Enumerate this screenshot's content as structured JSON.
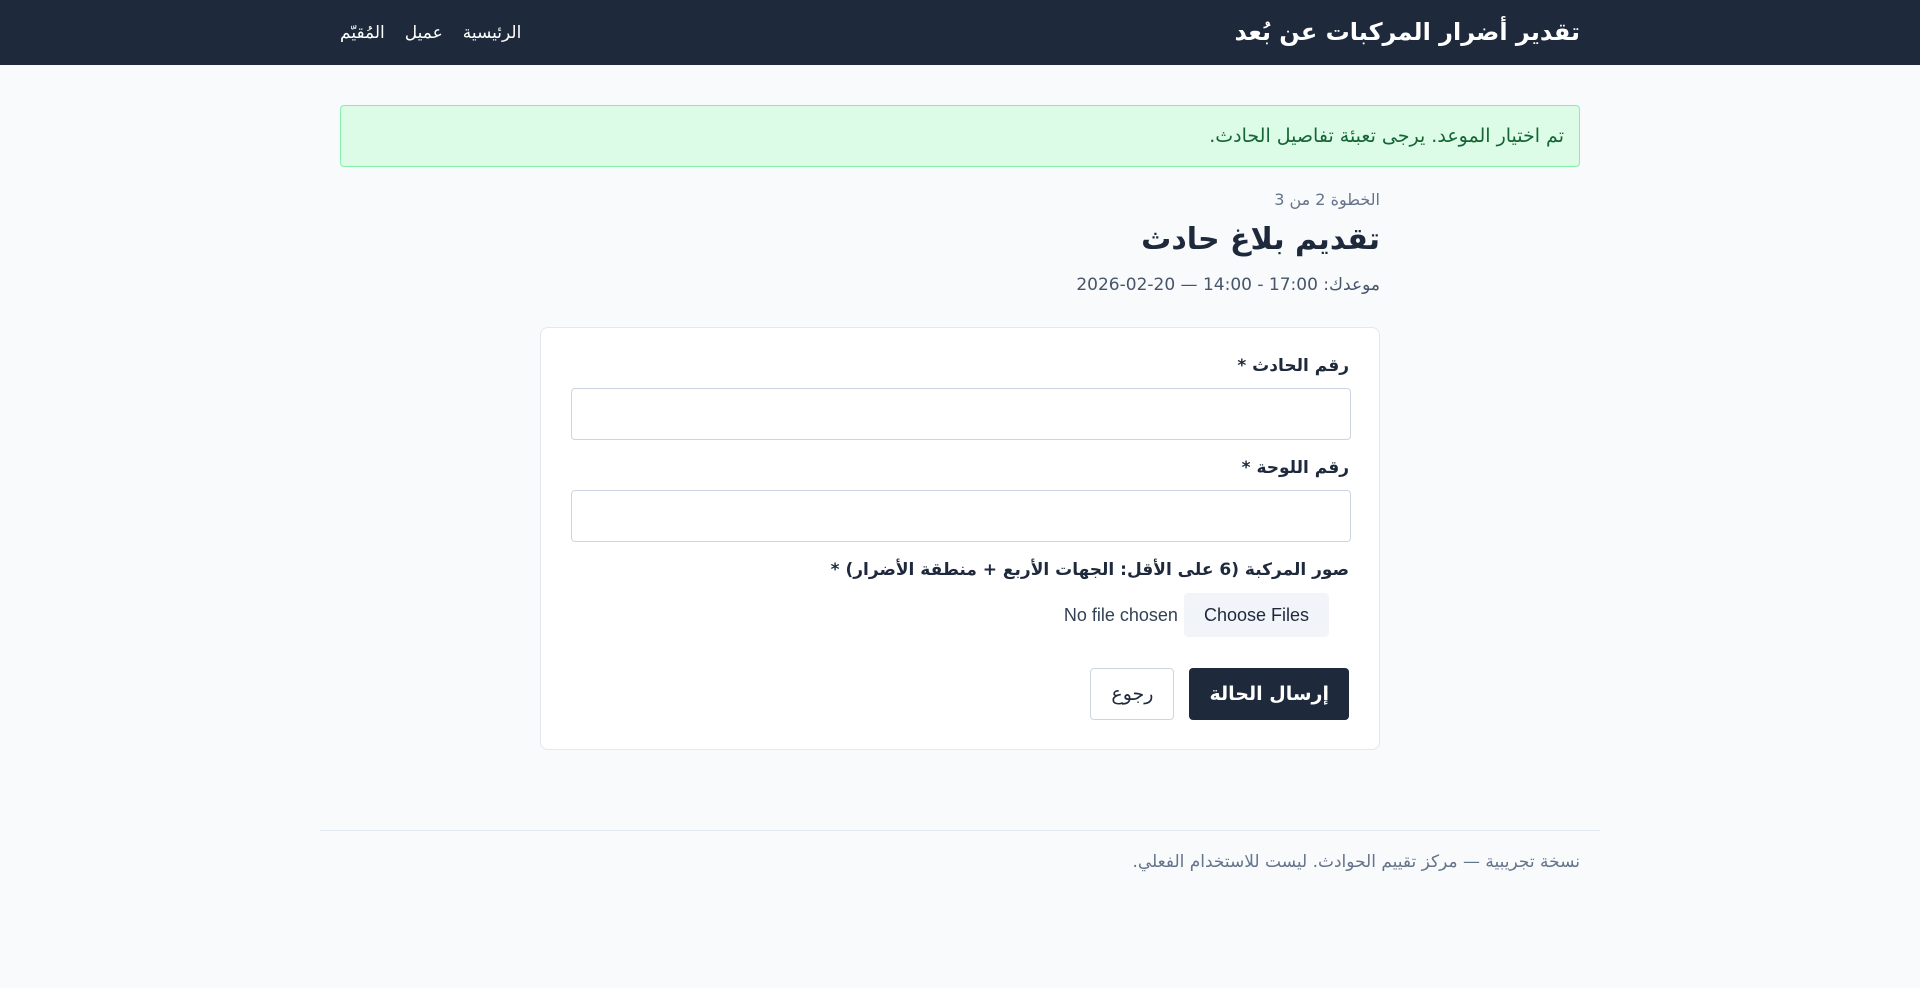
{
  "header": {
    "brand": "تقدير أضرار المركبات عن بُعد",
    "nav": [
      {
        "label": "الرئيسية"
      },
      {
        "label": "عميل"
      },
      {
        "label": "المُقيّم"
      }
    ]
  },
  "alert": {
    "message": "تم اختيار الموعد. يرجى تعبئة تفاصيل الحادث."
  },
  "page": {
    "step": "الخطوة 2 من 3",
    "title": "تقديم بلاغ حادث",
    "appointment_label": "موعدك:",
    "appointment_value": "2026-02-20 — 14:00 - 17:00"
  },
  "form": {
    "accident_number_label": "رقم الحادث *",
    "accident_number_value": "",
    "plate_number_label": "رقم اللوحة *",
    "plate_number_value": "",
    "photos_label": "صور المركبة (6 على الأقل: الجهات الأربع + منطقة الأضرار) *",
    "choose_files": "Choose Files",
    "no_file": "No file chosen",
    "submit_label": "إرسال الحالة",
    "back_label": "رجوع"
  },
  "footer": {
    "text": "نسخة تجريبية — مركز تقييم الحوادث. ليست للاستخدام الفعلي."
  },
  "colors": {
    "header_bg": "#1e293b",
    "page_bg": "#f8fafc",
    "alert_bg": "#dcfce7",
    "alert_text": "#166534",
    "primary": "#1e293b"
  }
}
